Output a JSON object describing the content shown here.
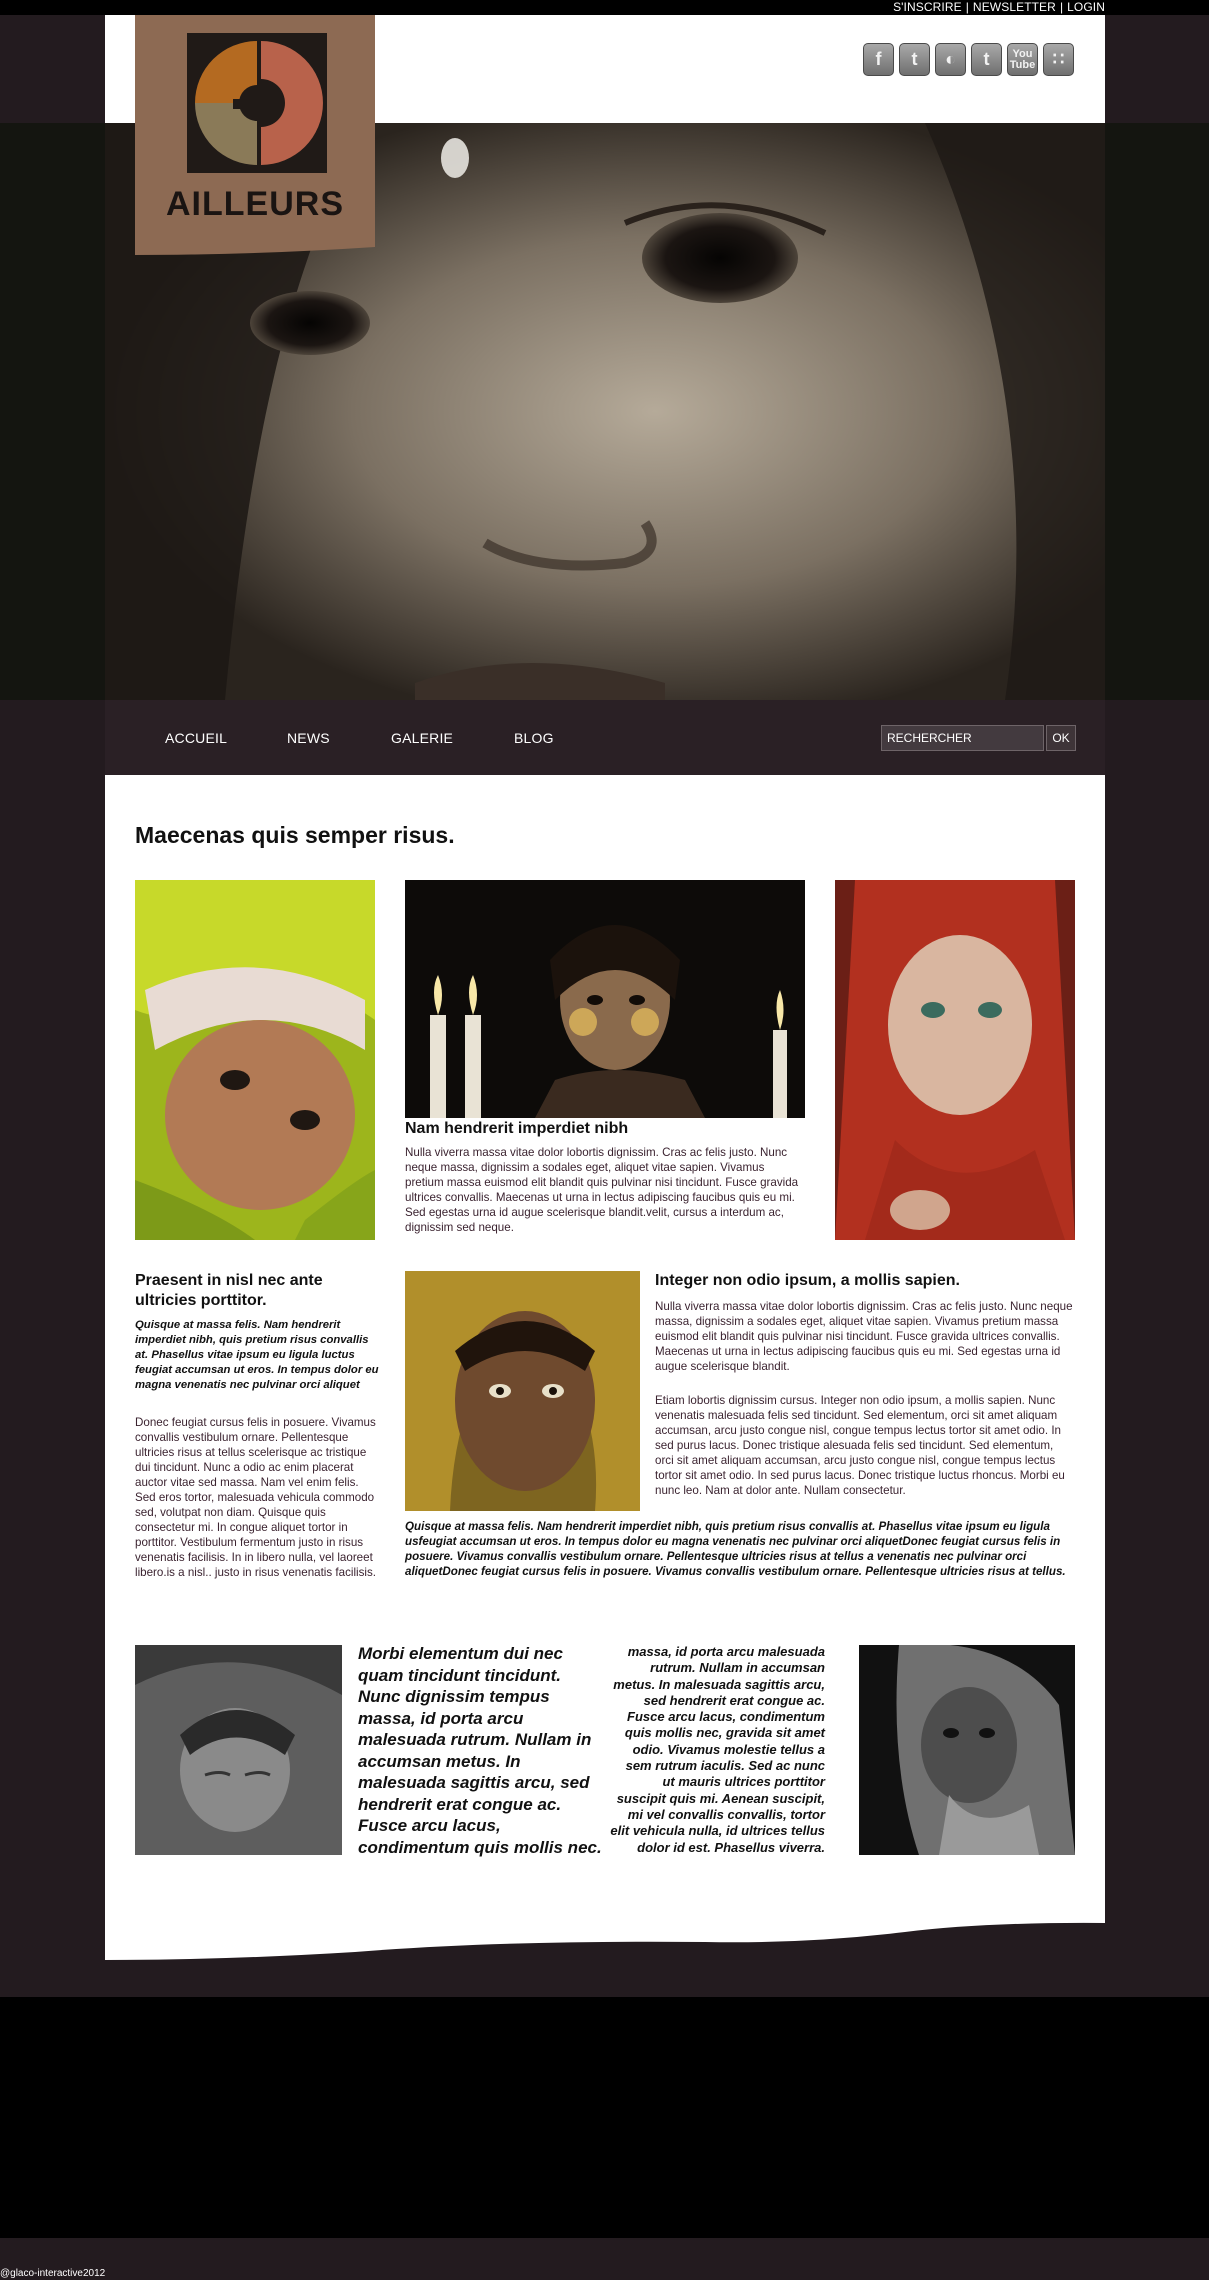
{
  "top_links": {
    "register": "S'INSCRIRE",
    "newsletter": "NEWSLETTER",
    "login": "LOGIN",
    "separator": "|"
  },
  "logo": {
    "text": "AILLEURS",
    "icon": "ailleurs-logo-mark"
  },
  "social": [
    {
      "name": "facebook-icon",
      "glyph": "f"
    },
    {
      "name": "twitter-icon",
      "glyph": "t"
    },
    {
      "name": "delicious-icon",
      "glyph": "◐"
    },
    {
      "name": "tumblr-icon",
      "glyph": "t"
    },
    {
      "name": "youtube-icon",
      "glyph": "You Tube"
    },
    {
      "name": "rss-icon",
      "glyph": "∷"
    }
  ],
  "nav": {
    "items": [
      "ACCUEIL",
      "NEWS",
      "GALERIE",
      "BLOG"
    ],
    "search_value": "RECHERCHER",
    "search_button": "OK"
  },
  "content": {
    "title": "Maecenas quis semper risus.",
    "center_heading": "Nam hendrerit imperdiet nibh",
    "center_text": "Nulla viverra massa vitae dolor lobortis dignissim. Cras ac felis justo. Nunc neque massa, dignissim a sodales eget, aliquet vitae sapien. Vivamus pretium massa euismod elit blandit quis pulvinar nisi tincidunt. Fusce gravida ultrices convallis. Maecenas ut urna in lectus adipiscing faucibus quis eu mi. Sed egestas urna id augue scelerisque blandit.velit, cursus a interdum ac, dignissim sed neque.",
    "left_heading": "Praesent in nisl nec ante ultricies porttitor.",
    "left_italic": "Quisque at massa felis. Nam hendrerit imperdiet nibh, quis pretium risus convallis at. Phasellus vitae ipsum eu ligula luctus feugiat accumsan ut eros. In tempus dolor eu magna venenatis nec pulvinar orci aliquet",
    "left_text": "Donec feugiat cursus felis in posuere. Vivamus convallis vestibulum ornare. Pellentesque ultricies risus at tellus scelerisque ac tristique dui tincidunt. Nunc a odio ac enim placerat auctor vitae sed massa. Nam vel enim felis. Sed eros tortor, malesuada vehicula commodo sed, volutpat non diam. Quisque quis consectetur mi. In congue aliquet tortor in porttitor. Vestibulum fermentum justo in risus venenatis facilisis. In in libero nulla, vel laoreet libero.is a nisl.. justo in risus venenatis facilisis.",
    "right_heading": "Integer non odio ipsum, a mollis sapien.",
    "right_text1": "Nulla viverra massa vitae dolor lobortis dignissim. Cras ac felis justo. Nunc neque massa, dignissim a sodales eget, aliquet vitae sapien. Vivamus pretium massa euismod elit blandit quis pulvinar nisi tincidunt. Fusce gravida ultrices convallis. Maecenas ut urna in lectus adipiscing faucibus quis eu mi. Sed egestas urna id augue scelerisque blandit.",
    "right_text2": "Etiam lobortis dignissim cursus. Integer non odio ipsum, a mollis sapien. Nunc venenatis malesuada felis sed tincidunt. Sed elementum, orci sit amet aliquam accumsan, arcu justo congue nisl, congue tempus lectus tortor sit amet odio. In sed purus lacus. Donec tristique alesuada felis sed tincidunt. Sed elementum, orci sit amet aliquam accumsan, arcu justo congue nisl, congue tempus lectus tortor sit amet odio. In sed purus lacus. Donec tristique luctus rhoncus. Morbi eu nunc leo. Nam at dolor ante. Nullam consectetur.",
    "wide_italic": "Quisque at massa felis. Nam hendrerit imperdiet nibh, quis pretium risus convallis at. Phasellus vitae ipsum eu ligula usfeugiat accumsan ut eros. In tempus dolor eu magna venenatis nec pulvinar orci aliquetDonec feugiat cursus felis in posuere. Vivamus convallis vestibulum ornare. Pellentesque ultricies risus at tellus a venenatis nec pulvinar orci aliquetDonec feugiat cursus felis in posuere. Vivamus convallis vestibulum ornare. Pellentesque ultricies risus at tellus.",
    "bottom_left_italic": "Morbi elementum dui nec quam tincidunt tincidunt. Nunc dignissim tempus massa, id porta arcu malesuada rutrum. Nullam in accumsan metus. In malesuada sagittis arcu, sed hendrerit erat congue ac. Fusce arcu lacus, condimentum quis mollis nec.",
    "bottom_right_italic": "massa, id porta arcu malesuada rutrum. Nullam in accumsan metus. In malesuada sagittis arcu, sed hendrerit erat congue ac. Fusce arcu lacus, condimentum quis mollis nec, gravida sit amet odio. Vivamus molestie tellus a sem rutrum iaculis. Sed ac nunc ut mauris ultrices porttitor suscipit quis mi. Aenean suscipit, mi vel convallis convallis, tortor elit vehicula nulla, id ultrices tellus dolor id est. Phasellus viverra."
  },
  "footer": {
    "copyright": "@glaco-interactive2012"
  },
  "colors": {
    "dark_band": "#231b1f",
    "hero_band": "#141510",
    "logo_bg": "#8d6a53",
    "logo_orange": "#b46a21",
    "logo_red": "#b8624b",
    "text_purple": "#3b2330"
  }
}
